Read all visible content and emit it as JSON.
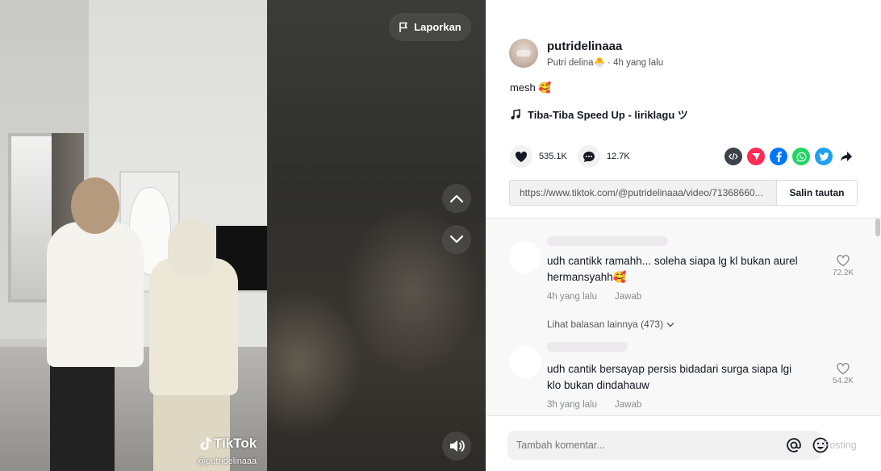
{
  "video": {
    "report_label": "Laporkan",
    "watermark_brand": "TikTok",
    "watermark_handle": "@putridelinaaa"
  },
  "author": {
    "username": "putridelinaaa",
    "display_name": "Putri delina🐣",
    "separator": " · ",
    "time": "4h yang lalu"
  },
  "caption": "mesh 🥰",
  "music": "Tiba-Tiba Speed Up - liriklagu ツ",
  "stats": {
    "likes": "535.1K",
    "comments": "12.7K"
  },
  "share_icons": [
    "embed-icon",
    "send-to-friends-icon",
    "facebook-icon",
    "whatsapp-icon",
    "twitter-icon",
    "share-arrow-icon"
  ],
  "link": {
    "url": "https://www.tiktok.com/@putridelinaaa/video/71368660...",
    "copy_label": "Salin tautan"
  },
  "comments": [
    {
      "text": "udh cantikk ramahh... soleha siapa lg kl bukan aurel hermansyahh🥰",
      "time": "4h yang lalu",
      "reply_label": "Jawab",
      "likes": "72.2K",
      "more_replies": "Lihat balasan lainnya (473)"
    },
    {
      "text": "udh cantik bersayap persis bidadari surga siapa lgi klo bukan dindahauw",
      "time": "3h yang lalu",
      "reply_label": "Jawab",
      "likes": "54.2K"
    }
  ],
  "comment_box": {
    "placeholder": "Tambah komentar...",
    "post_label": "Posting"
  },
  "colors": {
    "accent": "#fe2c55",
    "facebook": "#0075fa",
    "whatsapp": "#25d366",
    "twitter": "#1da1f2",
    "embed": "#3d4148"
  }
}
